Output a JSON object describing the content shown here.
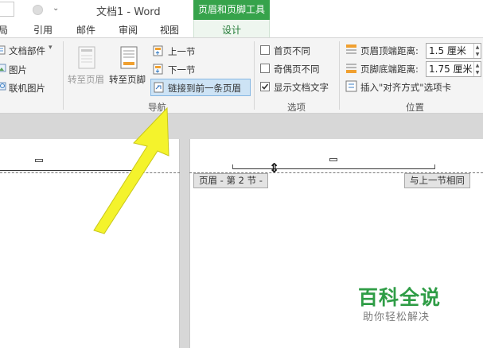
{
  "titlebar": {
    "doc_title": "文档1 - Word",
    "context_tab_group": "页眉和页脚工具"
  },
  "tabs": {
    "partial_home": "局",
    "references": "引用",
    "mailings": "邮件",
    "review": "审阅",
    "view": "视图",
    "design": "设计"
  },
  "insert_group": {
    "doc_parts": "文档部件",
    "doc_parts_arrow": "▾",
    "pictures": "图片",
    "online_pictures": "联机图片"
  },
  "navigation_group": {
    "goto_header": "转至页眉",
    "goto_footer": "转至页脚",
    "previous_section": "上一节",
    "next_section": "下一节",
    "link_to_previous": "链接到前一条页眉",
    "label": "导航"
  },
  "options_group": {
    "different_first_page": "首页不同",
    "different_odd_even": "奇偶页不同",
    "show_document_text": "显示文档文字",
    "label": "选项"
  },
  "position_group": {
    "header_from_top_label": "页眉顶端距离:",
    "header_from_top_value": "1.5 厘米",
    "footer_from_bottom_label": "页脚底端距离:",
    "footer_from_bottom_value": "1.75 厘米",
    "insert_alignment_tab": "插入\"对齐方式\"选项卡",
    "label": "位置"
  },
  "document": {
    "header_section_tag": "页眉 - 第 2 节 -",
    "same_as_previous_tag": "与上一节相同"
  },
  "watermark": {
    "brand": "百科全说",
    "slogan": "助你轻松解决"
  },
  "colors": {
    "context_green": "#36a34b",
    "arrow_yellow": "#f4f32c",
    "selected_button": "#cde3f5"
  }
}
